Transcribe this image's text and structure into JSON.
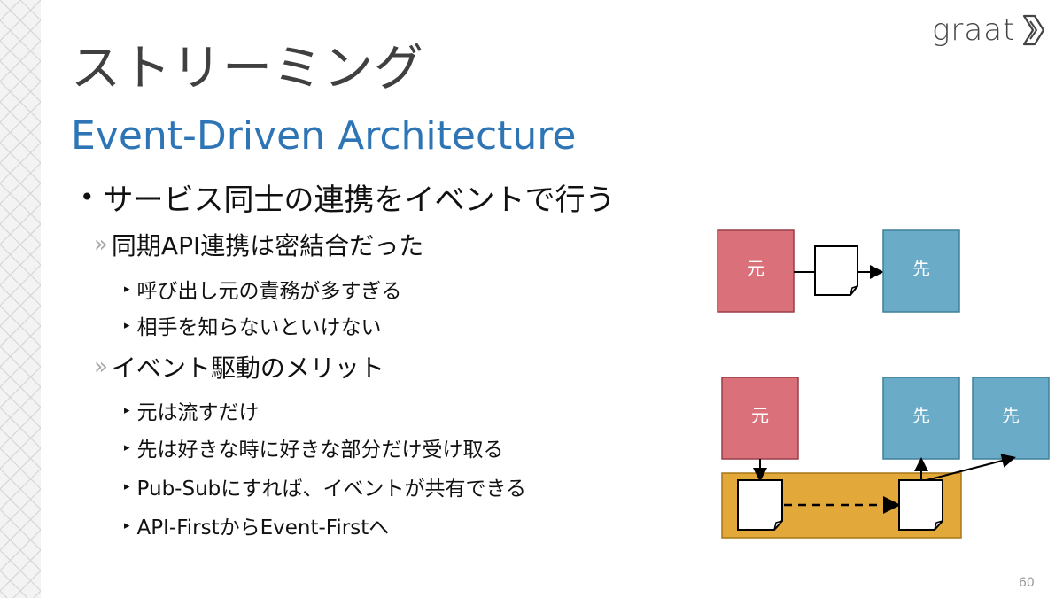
{
  "logo": {
    "text": "graat"
  },
  "title": "ストリーミング",
  "subtitle": "Event-Driven Architecture",
  "bullet1": {
    "mark": "•",
    "text": "サービス同士の連携をイベントで行う"
  },
  "sections": [
    {
      "mark": "»",
      "text": "同期API連携は密結合だった",
      "items": [
        {
          "mark": "▸",
          "text": "呼び出し元の責務が多すぎる"
        },
        {
          "mark": "▸",
          "text": "相手を知らないといけない"
        }
      ]
    },
    {
      "mark": "»",
      "text": "イベント駆動のメリット",
      "items": [
        {
          "mark": "▸",
          "text": "元は流すだけ"
        },
        {
          "mark": "▸",
          "text": "先は好きな時に好きな部分だけ受け取る"
        },
        {
          "mark": "▸",
          "text": "Pub-Subにすれば、イベントが共有できる"
        },
        {
          "mark": "▸",
          "text": "API-FirstからEvent-Firstへ"
        }
      ]
    }
  ],
  "diagram_top": {
    "source": "元",
    "target": "先"
  },
  "diagram_bottom": {
    "source": "元",
    "target1": "先",
    "target2": "先"
  },
  "colors": {
    "source_box": "#d9707a",
    "target_box": "#6aabc8",
    "broker": "#e2a93a",
    "title": "#404040",
    "subtitle": "#2e75b6"
  },
  "page_number": "60"
}
